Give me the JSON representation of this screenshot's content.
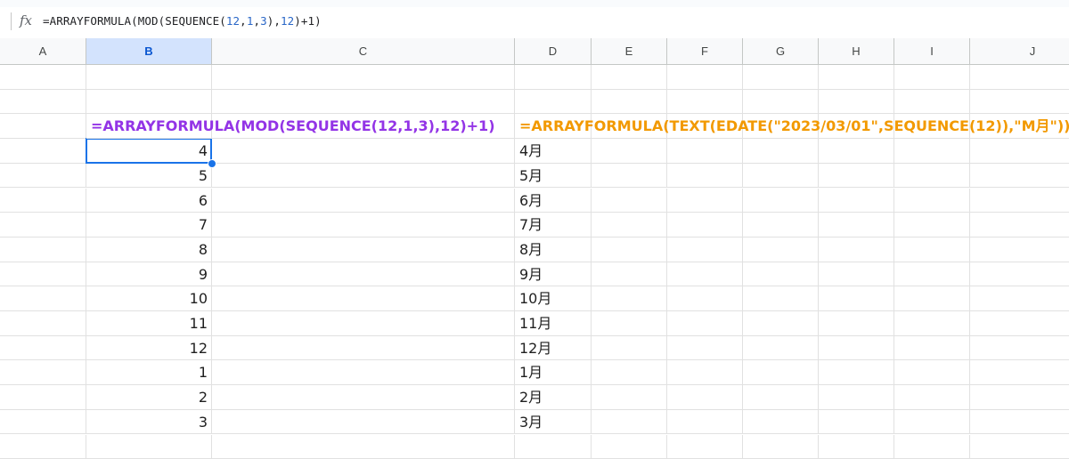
{
  "formula_bar": {
    "icon": "fx",
    "formula_parts": [
      {
        "t": "=ARRAYFORMULA(MOD(SEQUENCE(",
        "num": false
      },
      {
        "t": "12",
        "num": true
      },
      {
        "t": ",",
        "num": false
      },
      {
        "t": "1",
        "num": true
      },
      {
        "t": ",",
        "num": false
      },
      {
        "t": "3",
        "num": true
      },
      {
        "t": "),",
        "num": false
      },
      {
        "t": "12",
        "num": true
      },
      {
        "t": ")+1)",
        "num": false
      }
    ]
  },
  "columns": [
    "A",
    "B",
    "C",
    "D",
    "E",
    "F",
    "G",
    "H",
    "I",
    "J"
  ],
  "selected_column": "B",
  "formulas": {
    "b": "=ARRAYFORMULA(MOD(SEQUENCE(12,1,3),12)+1)",
    "d": "=ARRAYFORMULA(TEXT(EDATE(\"2023/03/01\",SEQUENCE(12)),\"M月\"))"
  },
  "values_b": [
    "4",
    "5",
    "6",
    "7",
    "8",
    "9",
    "10",
    "11",
    "12",
    "1",
    "2",
    "3"
  ],
  "values_d": [
    "4月",
    "5月",
    "6月",
    "7月",
    "8月",
    "9月",
    "10月",
    "11月",
    "12月",
    "1月",
    "2月",
    "3月"
  ],
  "colors": {
    "formula_b": "#9334e6",
    "formula_d": "#f29900",
    "selection": "#1a73e8"
  }
}
